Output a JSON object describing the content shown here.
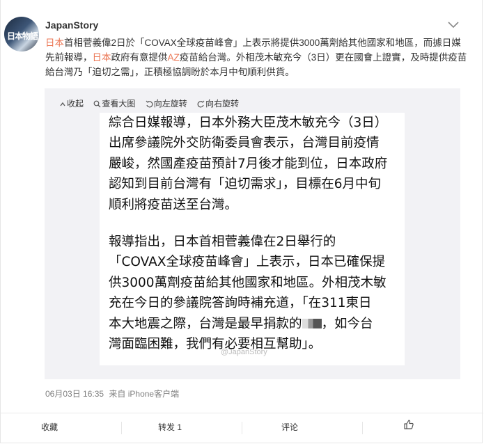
{
  "post": {
    "username": "JapanStory",
    "avatar_text": "日本物語",
    "text_segments": [
      {
        "text": "日本",
        "highlight": true
      },
      {
        "text": "首相菅義偉2日於「COVAX全球疫苗峰會」上表示將提供3000萬劑給其他國家和地區，而據日媒先前報導，",
        "highlight": false
      },
      {
        "text": "日本",
        "highlight": true
      },
      {
        "text": "政府有意提供",
        "highlight": false
      },
      {
        "text": "AZ",
        "highlight": true
      },
      {
        "text": "疫苗給台灣。外相茂木敏充今（3日）更在國會上證實，及時提供疫苗給台灣乃「迫切之需」，正積極協調盼於本月中旬順利供貨。",
        "highlight": false
      }
    ],
    "timestamp": "06月03日 16:35",
    "source": "来自 iPhone客户端"
  },
  "toolbar": {
    "collapse": "收起",
    "view_large": "查看大图",
    "rotate_left": "向左旋转",
    "rotate_right": "向右旋转"
  },
  "image_text": {
    "para1": [
      "綜合日媒報導，日本外務大臣茂木敏充今（3日）",
      "出席參議院外交防衛委員會表示，台灣目前疫情",
      "嚴峻，然國產疫苗預計7月後才能到位，日本政府",
      "認知到目前台灣有「迫切需求」，目標在6月中旬",
      "順利將疫苗送至台灣。"
    ],
    "para2": [
      "報導指出，日本首相菅義偉在2日舉行的",
      "「COVAX全球疫苗峰會」上表示，日本已確保提",
      "供3000萬劑疫苗給其他國家和地區。外相茂木敏",
      "充在今日的參議院答詢時補充道，「在311東日",
      "本大地震之際，台灣是最早捐款的",
      "灣面臨困難，我們有必要相互幫助」。"
    ],
    "para2_line5_tail": "，如今台",
    "watermark": "@JapanStory"
  },
  "footer": {
    "favorite": "收藏",
    "repost": "转发 1",
    "comment": "评论"
  },
  "colors": {
    "highlight": "#eb7350",
    "panel_bg": "#f2f2f5"
  }
}
